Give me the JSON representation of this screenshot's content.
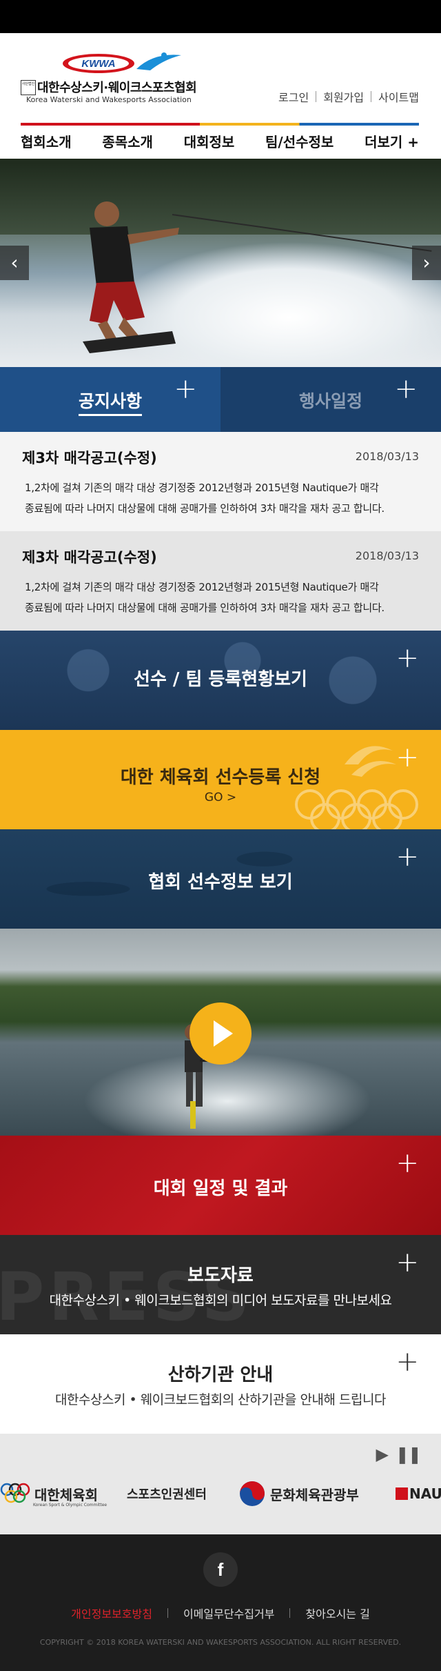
{
  "header": {
    "logo_mark": "KWWA",
    "logo_badge": "사단법인",
    "logo_korean": "대한수상스키·웨이크스포츠협회",
    "logo_english": "Korea Waterski and Wakesports Association",
    "util": {
      "login": "로그인",
      "join": "회원가입",
      "sitemap": "사이트맵"
    }
  },
  "nav": {
    "items": [
      {
        "label": "협회소개"
      },
      {
        "label": "종목소개"
      },
      {
        "label": "대회정보"
      },
      {
        "label": "팀/선수정보"
      },
      {
        "label": "더보기 +"
      }
    ]
  },
  "hero": {
    "prev": "‹",
    "next": "›"
  },
  "tabs": [
    {
      "label": "공지사항",
      "plus": "+"
    },
    {
      "label": "행사일정",
      "plus": "+"
    }
  ],
  "notices": [
    {
      "title": "제3차 매각공고(수정)",
      "date": "2018/03/13",
      "body_line1": "1,2차에 걸쳐 기존의 매각 대상 경기정중 2012년형과 2015년형 Nautique가 매각",
      "body_line2": "종료됨에 따라 나머지 대상물에 대해 공매가를 인하하여 3차 매각을 재차 공고 합니다."
    },
    {
      "title": "제3차 매각공고(수정)",
      "date": "2018/03/13",
      "body_line1": "1,2차에 걸쳐 기존의 매각 대상 경기정중 2012년형과 2015년형 Nautique가 매각",
      "body_line2": "종료됨에 따라 나머지 대상물에 대해 공매가를 인하하여 3차 매각을 재차 공고 합니다."
    }
  ],
  "bands": {
    "registration": {
      "title": "선수 / 팀 등록현황보기",
      "plus": "+"
    },
    "kspo": {
      "title": "대한 체육회 선수등록 신청",
      "go": "GO >",
      "plus": "+"
    },
    "athletes": {
      "title": "협회 선수정보 보기",
      "plus": "+"
    },
    "results": {
      "title": "대회 일정 및 결과",
      "plus": "+"
    },
    "press": {
      "title": "보도자료",
      "subtitle": "대한수상스키 • 웨이크보드협회의 미디어 보도자료를 만나보세요",
      "bg_word": "PRESS",
      "plus": "+"
    },
    "orgs": {
      "title": "산하기관 안내",
      "subtitle": "대한수상스키 • 웨이크보드협회의 산하기관을 안내해 드립니다",
      "plus": "+"
    }
  },
  "partners": {
    "controls": {
      "play": "▶",
      "pause": "❚❚"
    },
    "items": [
      {
        "name": "대한체육회",
        "sub": "Korean Sport & Olympic Committee"
      },
      {
        "name": "스포츠인권센터"
      },
      {
        "name": "문화체육관광부"
      },
      {
        "name": "NAU"
      }
    ]
  },
  "footer": {
    "facebook": "f",
    "links": {
      "privacy": "개인정보보호방침",
      "email": "이메일무단수집거부",
      "directions": "찾아오시는 길"
    },
    "copyright": "COPYRIGHT © 2018 KOREA WATERSKI AND WAKESPORTS ASSOCIATION. ALL RIGHT RESERVED."
  }
}
